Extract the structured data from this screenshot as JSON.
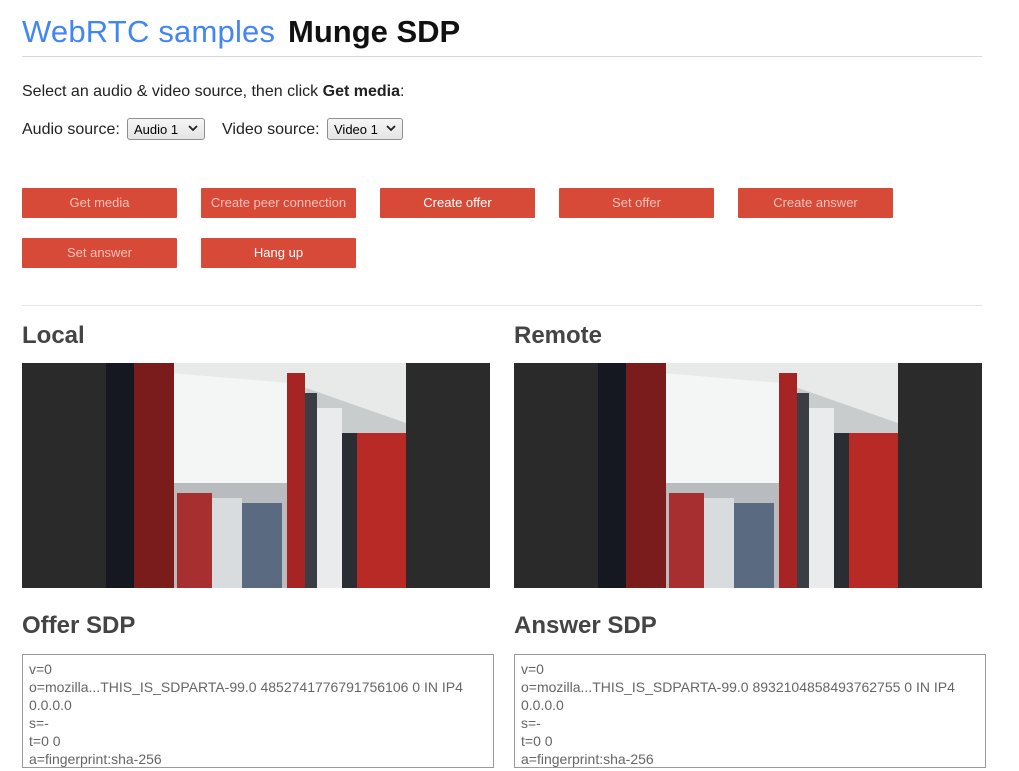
{
  "header": {
    "brand": "WebRTC samples",
    "title": "Munge SDP"
  },
  "instructions": {
    "prefix": "Select an audio & video source, then click ",
    "bold": "Get media",
    "suffix": ":"
  },
  "sources": {
    "audio_label": "Audio source:",
    "audio_value": "Audio 1",
    "video_label": "Video source:",
    "video_value": "Video 1"
  },
  "buttons": {
    "get_media": "Get media",
    "create_peer": "Create peer connection",
    "create_offer": "Create offer",
    "set_offer": "Set offer",
    "create_answer": "Create answer",
    "set_answer": "Set answer",
    "hang_up": "Hang up"
  },
  "local": {
    "heading": "Local"
  },
  "remote": {
    "heading": "Remote"
  },
  "offer": {
    "heading": "Offer SDP",
    "lines": [
      "v=0",
      "o=mozilla...THIS_IS_SDPARTA-99.0 4852741776791756106 0 IN IP4",
      "0.0.0.0",
      "s=-",
      "t=0 0",
      "a=fingerprint:sha-256"
    ]
  },
  "answer": {
    "heading": "Answer SDP",
    "lines": [
      "v=0",
      "o=mozilla...THIS_IS_SDPARTA-99.0 8932104858493762755 0 IN IP4",
      "0.0.0.0",
      "s=-",
      "t=0 0",
      "a=fingerprint:sha-256"
    ]
  },
  "colors": {
    "brand": "#4285f4",
    "button": "#d84a38"
  }
}
